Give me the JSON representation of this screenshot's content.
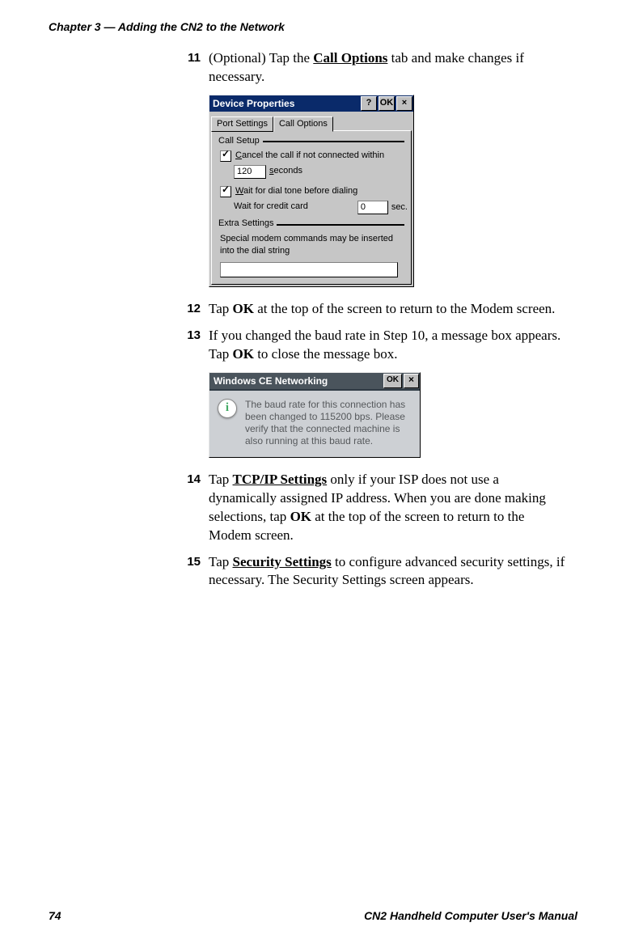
{
  "header": "Chapter 3 — Adding the CN2 to the Network",
  "footer": {
    "page": "74",
    "manual": "CN2 Handheld Computer User's Manual"
  },
  "step11": {
    "num": "11",
    "pre": "(Optional) Tap the ",
    "bold": "Call Options",
    "post": " tab and make changes if necessary."
  },
  "devprops": {
    "title": "Device Properties",
    "btn_help": "?",
    "btn_ok": "OK",
    "btn_close": "×",
    "tab_port": "Port Settings",
    "tab_call": "Call Options",
    "group_call_setup": "Call Setup",
    "cancel_pre": "C",
    "cancel_rest": "ancel the call if not connected within",
    "timeout_value": "120",
    "timeout_unit_u": "s",
    "timeout_unit_rest": "econds",
    "wait_dial_u": "W",
    "wait_dial_rest": "ait for dial tone before dialing",
    "wait_credit": "Wait for credit card",
    "credit_value": "0",
    "credit_unit": "sec.",
    "group_extra": "Extra Settings",
    "extra_note": "Special modem commands may be inserted into the dial string",
    "extra_value": ""
  },
  "step12": {
    "num": "12",
    "pre": "Tap ",
    "bold": "OK",
    "post": " at the top of the screen to return to the Modem screen."
  },
  "step13": {
    "num": "13",
    "pre": "If you changed the baud rate in Step 10, a message box appears. Tap ",
    "bold": "OK",
    "post": " to close the message box."
  },
  "msgbox": {
    "title": "Windows CE Networking",
    "btn_ok": "OK",
    "btn_close": "×",
    "icon": "i",
    "text": "The baud rate for this connection has been changed to 115200 bps. Please verify that the connected machine is also running at this baud rate."
  },
  "step14": {
    "num": "14",
    "pre": "Tap ",
    "bu": "TCP/IP Settings",
    "mid1": " only if your ISP does not use a dynamically assigned IP address. When you are done making selections, tap ",
    "bold": "OK",
    "post": " at the top of the screen to return to the Modem screen."
  },
  "step15": {
    "num": "15",
    "pre": "Tap ",
    "bu": "Security Settings",
    "post": " to configure advanced security settings, if necessary. The Security Settings screen appears."
  }
}
